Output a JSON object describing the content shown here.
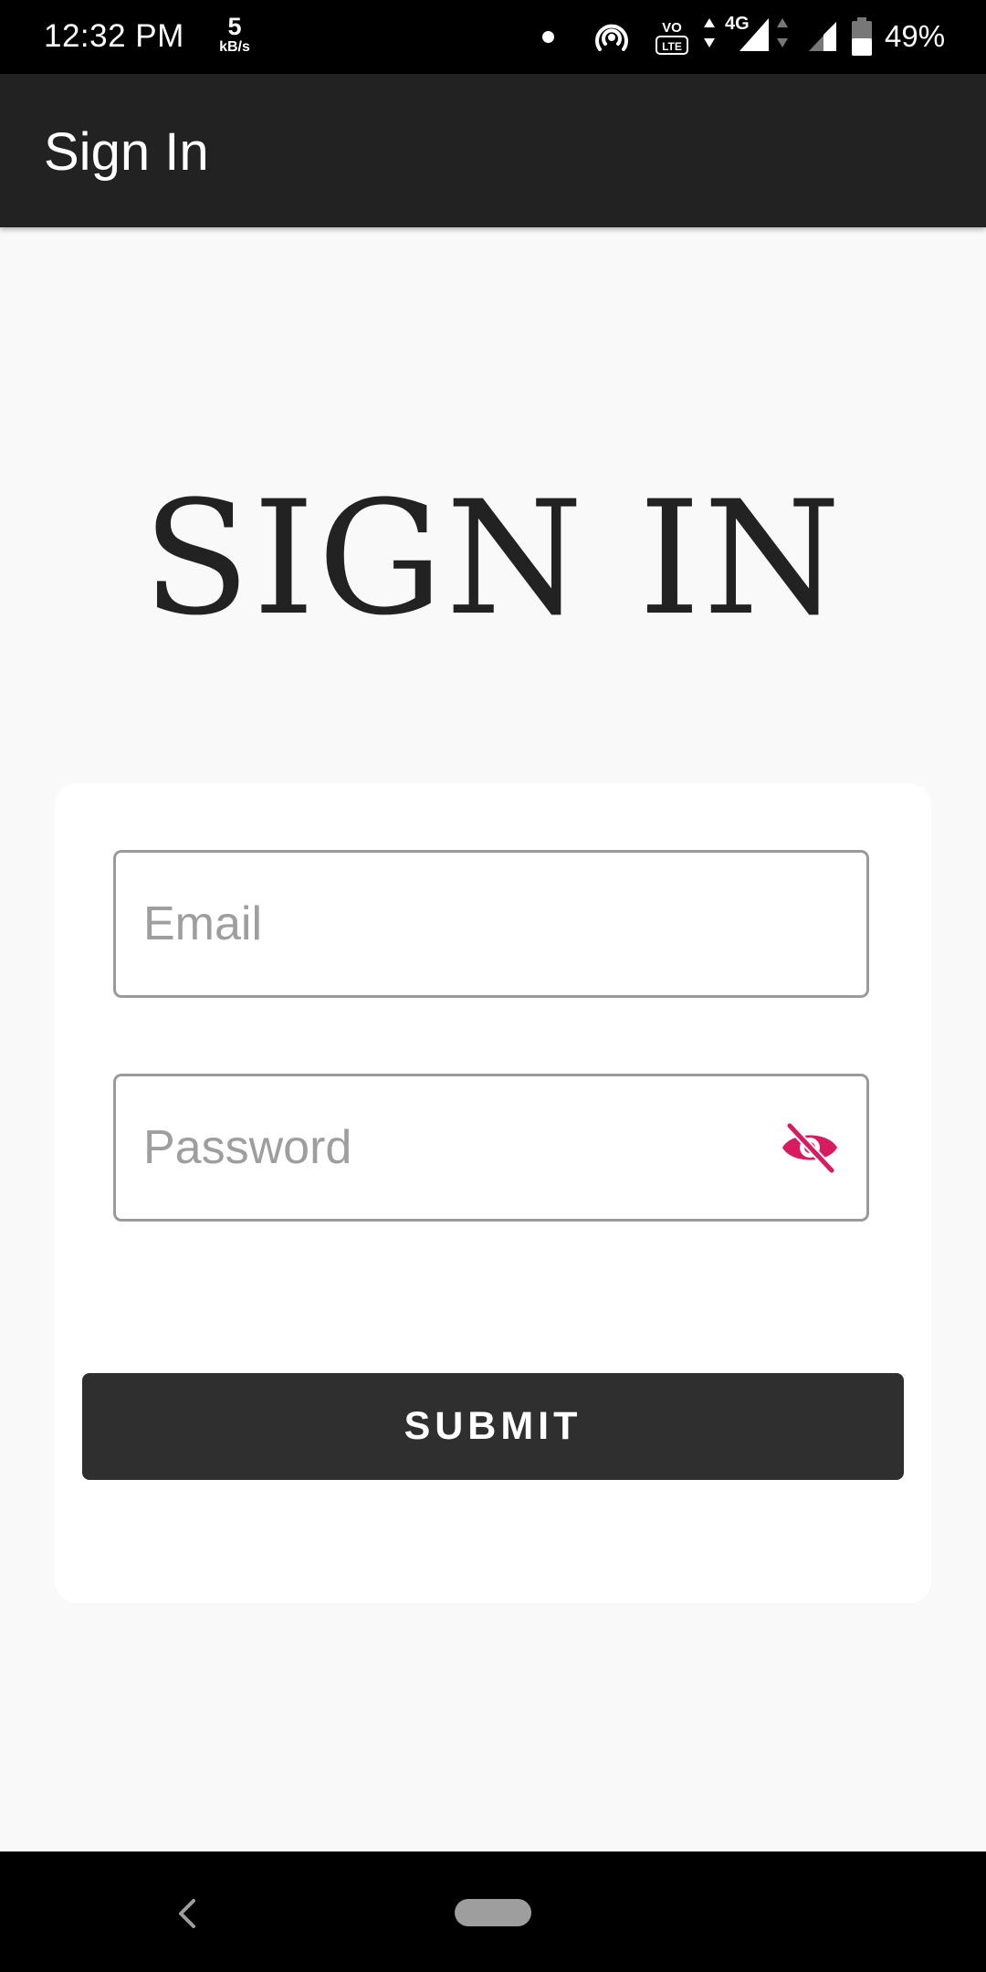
{
  "status_bar": {
    "time": "12:32 PM",
    "speed_value": "5",
    "speed_unit": "kB/s",
    "volte_top": "VO",
    "volte_bottom": "LTE",
    "network_type": "4G",
    "battery_percent": "49%"
  },
  "app_bar": {
    "title": "Sign In"
  },
  "page": {
    "heading": "SIGN IN"
  },
  "form": {
    "email_placeholder": "Email",
    "email_value": "",
    "password_placeholder": "Password",
    "password_value": "",
    "submit_label": "SUBMIT"
  },
  "colors": {
    "app_bar_bg": "#222222",
    "page_bg": "#f9f9f9",
    "card_bg": "#ffffff",
    "button_bg": "#2f2f2f",
    "visibility_icon": "#d81b60",
    "field_border": "#9a9a9a"
  },
  "icons": {
    "password_toggle": "visibility-off-icon",
    "nav_back": "back-chevron-icon",
    "nav_home": "home-pill-icon"
  }
}
